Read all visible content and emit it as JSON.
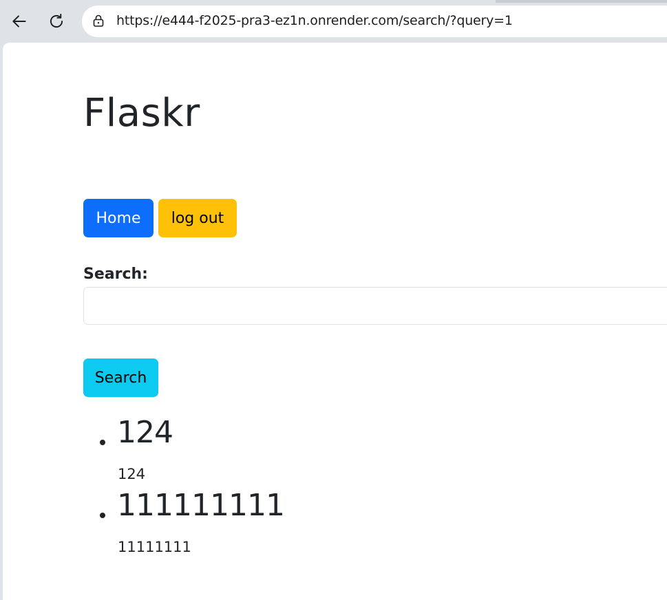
{
  "browser": {
    "url": "https://e444-f2025-pra3-ez1n.onrender.com/search/?query=1",
    "icons": {
      "back": "arrow-left-icon",
      "reload": "reload-icon",
      "lock": "lock-icon"
    }
  },
  "page": {
    "site_title": "Flaskr",
    "nav": {
      "home_label": "Home",
      "logout_label": "log out"
    },
    "search": {
      "label": "Search:",
      "value": "",
      "button_label": "Search"
    },
    "results": [
      {
        "title": "124",
        "body": "124"
      },
      {
        "title": "111111111",
        "body": "11111111"
      }
    ]
  },
  "colors": {
    "primary": "#0d6efd",
    "warning": "#ffc107",
    "info": "#0dcaf0",
    "text": "#212529",
    "browser_chrome": "#dfe3e8"
  }
}
